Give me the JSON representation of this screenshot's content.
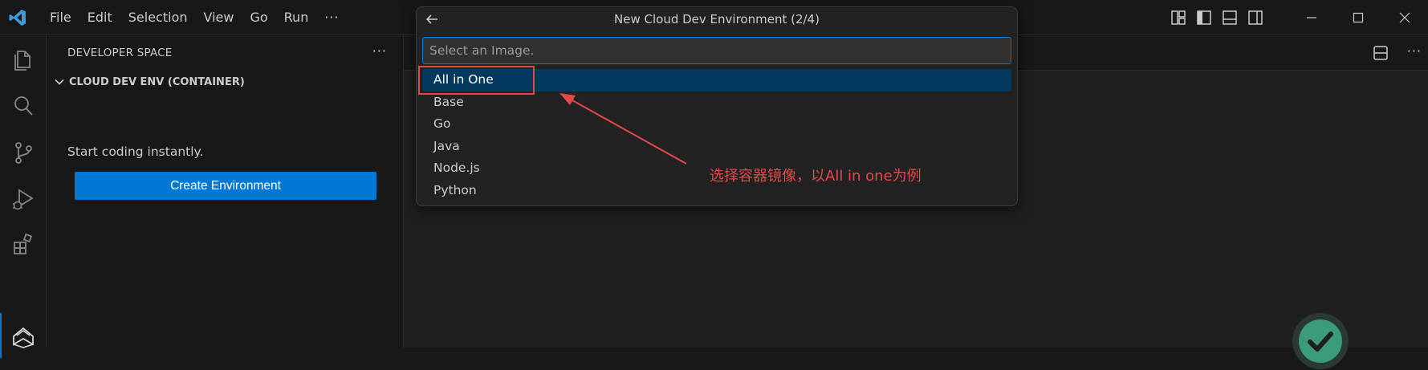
{
  "titlebar": {
    "menu": [
      "File",
      "Edit",
      "Selection",
      "View",
      "Go",
      "Run",
      "···"
    ]
  },
  "sidebar": {
    "title": "DEVELOPER SPACE",
    "more": "···",
    "section_label": "CLOUD DEV ENV (CONTAINER)",
    "intro_text": "Start coding instantly.",
    "create_button": "Create Environment"
  },
  "editor": {
    "more": "···"
  },
  "quickpick": {
    "title": "New Cloud Dev Environment (2/4)",
    "placeholder": "Select an Image.",
    "items": [
      "All in One",
      "Base",
      "Go",
      "Java",
      "Node.js",
      "Python"
    ],
    "selected_index": 0
  },
  "annotation": {
    "text": "选择容器镜像，以All in one为例",
    "color": "#e5474a"
  },
  "colors": {
    "accent": "#0078d4",
    "selection": "#04395e",
    "success": "#3a9c78"
  }
}
